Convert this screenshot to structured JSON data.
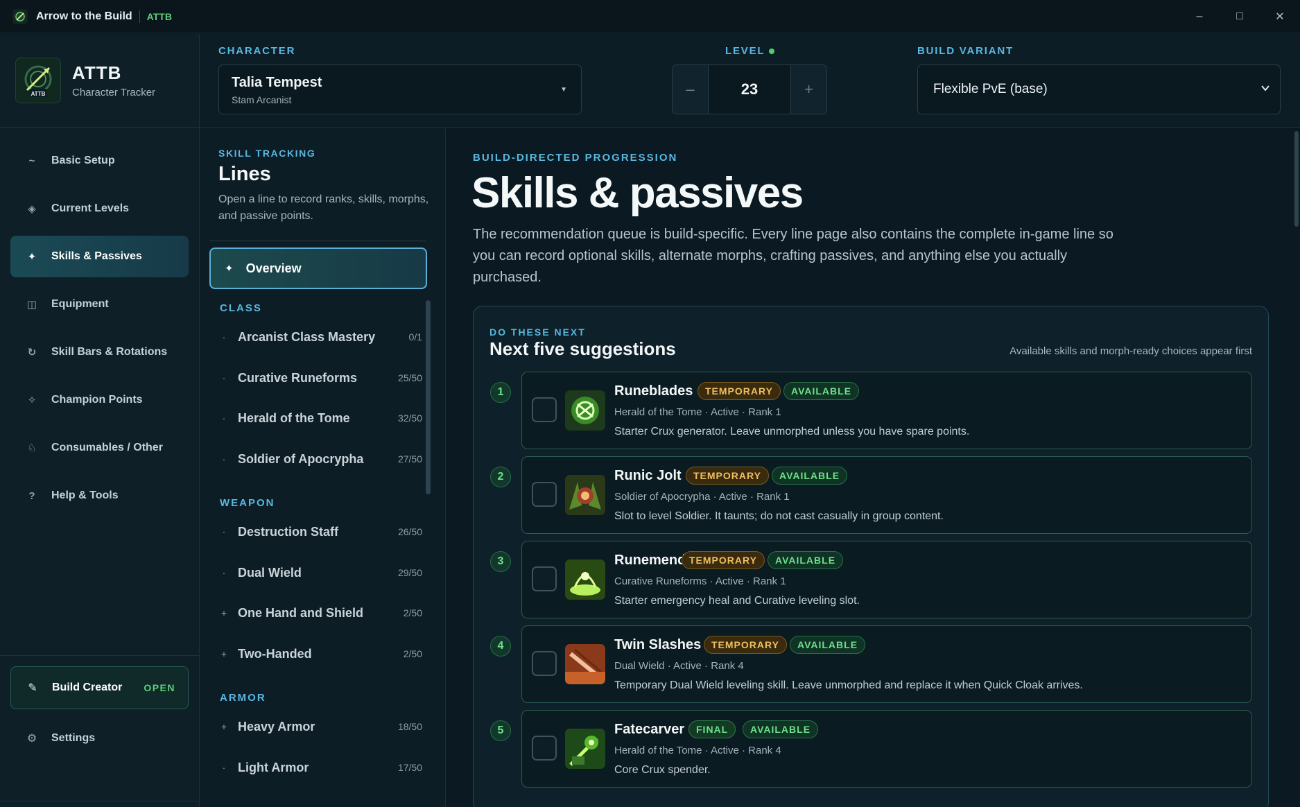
{
  "window": {
    "title": "Arrow to the Build",
    "tag": "ATTB",
    "controls": {
      "minimize": "–",
      "maximize": "□",
      "close": "✕"
    }
  },
  "brand": {
    "name": "ATTB",
    "subtitle": "Character Tracker",
    "logo_text": "ATTB"
  },
  "sidebar": {
    "items": [
      {
        "label": "Basic Setup",
        "icon": "~",
        "icon_name": "tilde-icon",
        "active": false
      },
      {
        "label": "Current Levels",
        "icon": "◈",
        "icon_name": "diamond-icon",
        "active": false
      },
      {
        "label": "Skills & Passives",
        "icon": "✦",
        "icon_name": "sparkle-icon",
        "active": true
      },
      {
        "label": "Equipment",
        "icon": "◫",
        "icon_name": "equipment-icon",
        "active": false
      },
      {
        "label": "Skill Bars & Rotations",
        "icon": "↻",
        "icon_name": "rotate-icon",
        "active": false
      },
      {
        "label": "Champion Points",
        "icon": "✧",
        "icon_name": "star-outline-icon",
        "active": false
      },
      {
        "label": "Consumables / Other",
        "icon": "♘",
        "icon_name": "consumables-icon",
        "active": false
      },
      {
        "label": "Help & Tools",
        "icon": "?",
        "icon_name": "help-icon",
        "active": false
      }
    ],
    "build_creator": {
      "label": "Build Creator",
      "status": "OPEN",
      "icon": "✎"
    },
    "settings": {
      "label": "Settings",
      "icon": "⚙"
    },
    "collapse": "‹"
  },
  "header": {
    "character_label": "CHARACTER",
    "character_name": "Talia Tempest",
    "character_class": "Stam Arcanist",
    "level_label": "LEVEL",
    "level_value": "23",
    "level_minus": "–",
    "level_plus": "+",
    "variant_label": "BUILD VARIANT",
    "variant_value": "Flexible PvE (base)"
  },
  "lines_panel": {
    "kicker": "SKILL TRACKING",
    "title": "Lines",
    "description": "Open a line to record ranks, skills, morphs, and passive points.",
    "overview": "Overview",
    "sections": [
      {
        "title": "CLASS",
        "items": [
          {
            "bullet": "·",
            "name": "Arcanist Class Mastery",
            "count": "0/1"
          },
          {
            "bullet": "·",
            "name": "Curative Runeforms",
            "count": "25/50"
          },
          {
            "bullet": "·",
            "name": "Herald of the Tome",
            "count": "32/50"
          },
          {
            "bullet": "·",
            "name": "Soldier of Apocrypha",
            "count": "27/50"
          }
        ]
      },
      {
        "title": "WEAPON",
        "items": [
          {
            "bullet": "·",
            "name": "Destruction Staff",
            "count": "26/50"
          },
          {
            "bullet": "·",
            "name": "Dual Wield",
            "count": "29/50"
          },
          {
            "bullet": "+",
            "name": "One Hand and Shield",
            "count": "2/50"
          },
          {
            "bullet": "+",
            "name": "Two-Handed",
            "count": "2/50"
          }
        ]
      },
      {
        "title": "ARMOR",
        "items": [
          {
            "bullet": "+",
            "name": "Heavy Armor",
            "count": "18/50"
          },
          {
            "bullet": "·",
            "name": "Light Armor",
            "count": "17/50"
          }
        ]
      }
    ]
  },
  "main": {
    "kicker": "BUILD-DIRECTED PROGRESSION",
    "title": "Skills & passives",
    "description": "The recommendation queue is build-specific. Every line page also contains the complete in-game line so you can record optional skills, alternate morphs, crafting passives, and anything else you actually purchased.",
    "card": {
      "kicker": "DO THESE NEXT",
      "title": "Next five suggestions",
      "note": "Available skills and morph-ready choices appear first",
      "suggestions": [
        {
          "num": "1",
          "name": "Runeblades",
          "type": "TEMPORARY",
          "status": "AVAILABLE",
          "meta": "Herald of the Tome · Active · Rank 1",
          "desc": "Starter Crux generator. Leave unmorphed unless you have spare points."
        },
        {
          "num": "2",
          "name": "Runic Jolt",
          "type": "TEMPORARY",
          "status": "AVAILABLE",
          "meta": "Soldier of Apocrypha · Active · Rank 1",
          "desc": "Slot to level Soldier. It taunts; do not cast casually in group content."
        },
        {
          "num": "3",
          "name": "Runemend",
          "type": "TEMPORARY",
          "status": "AVAILABLE",
          "meta": "Curative Runeforms · Active · Rank 1",
          "desc": "Starter emergency heal and Curative leveling slot."
        },
        {
          "num": "4",
          "name": "Twin Slashes",
          "type": "TEMPORARY",
          "status": "AVAILABLE",
          "meta": "Dual Wield · Active · Rank 4",
          "desc": "Temporary Dual Wield leveling skill. Leave unmorphed and replace it when Quick Cloak arrives."
        },
        {
          "num": "5",
          "name": "Fatecarver",
          "type": "FINAL",
          "status": "AVAILABLE",
          "meta": "Herald of the Tome · Active · Rank 4",
          "desc": "Core Crux spender."
        }
      ]
    }
  },
  "colors": {
    "accent_blue": "#59b8e0",
    "accent_green": "#5fd07a",
    "badge_temporary": "#f0c060",
    "background": "#0b1820"
  }
}
